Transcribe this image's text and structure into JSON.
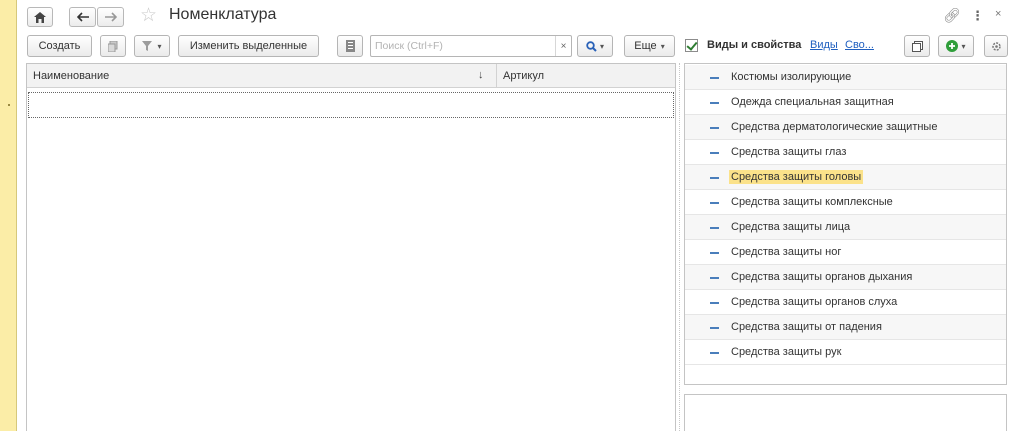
{
  "window": {
    "title": "Номенклатура",
    "home_icon": "home-icon",
    "back_icon": "arrow-left-icon",
    "forward_icon": "arrow-right-icon",
    "favorite_icon": "star-icon",
    "link_icon": "link-icon",
    "more_icon": "more-vertical-icon",
    "close_icon": "close-icon"
  },
  "toolbar": {
    "create_label": "Создать",
    "change_selected_label": "Изменить выделенные",
    "search_placeholder": "Поиск (Ctrl+F)",
    "more_label": "Еще"
  },
  "grid": {
    "columns": [
      "Наименование",
      "Артикул"
    ],
    "sort_indicator": "↓",
    "rows": []
  },
  "right_panel": {
    "checkbox_checked": true,
    "title": "Виды и свойства",
    "link1": "Виды",
    "link2": "Сво...",
    "items": [
      "Костюмы изолирующие",
      "Одежда специальная защитная",
      "Средства дерматологические защитные",
      "Средства защиты глаз",
      "Средства защиты головы",
      "Средства защиты комплексные",
      "Средства защиты лица",
      "Средства защиты ног",
      "Средства защиты органов дыхания",
      "Средства защиты органов слуха",
      "Средства защиты от падения",
      "Средства защиты рук"
    ],
    "selected_item": "Средства защиты головы"
  },
  "colors": {
    "selection": "#fbe28a",
    "link": "#1f5fbf",
    "accent_green": "#2f9e3a",
    "left_strip": "#fbeda7"
  }
}
